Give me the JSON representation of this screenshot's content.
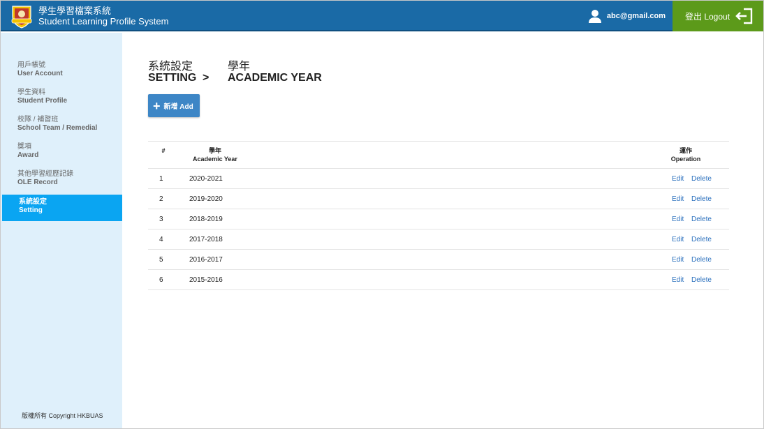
{
  "header": {
    "title_zh": "學生學習檔案系統",
    "title_en": "Student Learning Profile System",
    "user_email": "abc@gmail.com",
    "logout_label": "登出 Logout",
    "colors": {
      "bar": "#1a6aa6",
      "logout": "#5c9a1a"
    }
  },
  "sidebar": {
    "items": [
      {
        "zh": "用戶帳號",
        "en": "User Account"
      },
      {
        "zh": "學生資料",
        "en": "Student Profile"
      },
      {
        "zh": "校隊 / 補習班",
        "en": "School Team / Remedial"
      },
      {
        "zh": "獎項",
        "en": "Award"
      },
      {
        "zh": "其他學習經歷記錄",
        "en": "OLE Record"
      },
      {
        "zh": "系統設定",
        "en": "Setting"
      }
    ],
    "active_index": 5,
    "copyright": "版權所有 Copyright  HKBUAS",
    "colors": {
      "bg": "#dff0fb",
      "active": "#0aa5f2"
    }
  },
  "breadcrumb": {
    "parent_zh": "系統設定",
    "parent_en": "SETTING",
    "separator": ">",
    "current_zh": "學年",
    "current_en": "ACADEMIC YEAR"
  },
  "add_button": {
    "icon": "plus-icon",
    "label": "新增 Add"
  },
  "table": {
    "headers": {
      "num": "#",
      "year_zh": "學年",
      "year_en": "Academic Year",
      "op_zh": "運作",
      "op_en": "Operation"
    },
    "rows": [
      {
        "num": "1",
        "year": "2020-2021",
        "edit": "Edit",
        "delete": "Delete"
      },
      {
        "num": "2",
        "year": "2019-2020",
        "edit": "Edit",
        "delete": "Delete"
      },
      {
        "num": "3",
        "year": "2018-2019",
        "edit": "Edit",
        "delete": "Delete"
      },
      {
        "num": "4",
        "year": "2017-2018",
        "edit": "Edit",
        "delete": "Delete"
      },
      {
        "num": "5",
        "year": "2016-2017",
        "edit": "Edit",
        "delete": "Delete"
      },
      {
        "num": "6",
        "year": "2015-2016",
        "edit": "Edit",
        "delete": "Delete"
      }
    ]
  }
}
